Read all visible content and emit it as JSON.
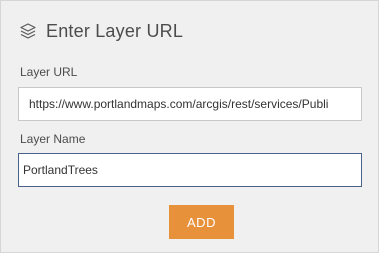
{
  "header": {
    "icon": "layers-icon",
    "title": "Enter Layer URL"
  },
  "form": {
    "url_label": "Layer URL",
    "url_value": "https://www.portlandmaps.com/arcgis/rest/services/Publi",
    "name_label": "Layer Name",
    "name_value": "PortlandTrees",
    "add_label": "ADD"
  },
  "colors": {
    "accent": "#e8913b",
    "focus_border": "#49628a",
    "panel_bg": "#f0f0f0"
  }
}
